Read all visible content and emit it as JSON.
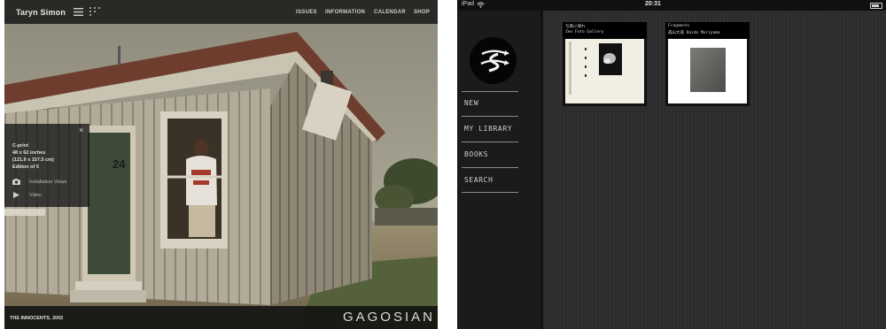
{
  "website": {
    "brand": "Taryn Simon",
    "nav": [
      "ISSUES",
      "INFORMATION",
      "CALENDAR",
      "SHOP"
    ],
    "info_panel": {
      "close_glyph": "×",
      "medium": "C-print",
      "size_in": "48 x 62 inches",
      "size_cm": "(121.9 x 157.5 cm)",
      "edition": "Edition of 5",
      "links": [
        {
          "label": "Installation Views",
          "icon": "camera-icon"
        },
        {
          "label": "Video",
          "icon": "play-icon"
        }
      ]
    },
    "door_number": "24",
    "caption": "THE INNOCENTS, 2002",
    "gallery": "GAGOSIAN"
  },
  "ipad": {
    "status": {
      "device": "iPad",
      "time": "20:31"
    },
    "menu": [
      "NEW",
      "MY LIBRARY",
      "BOOKS",
      "SEARCH"
    ],
    "books": [
      {
        "title": "写真に帰れ",
        "author": "Zen Foto Gallery"
      },
      {
        "title": "Fragments",
        "author": "森山大道 Daido Moriyama"
      }
    ]
  }
}
